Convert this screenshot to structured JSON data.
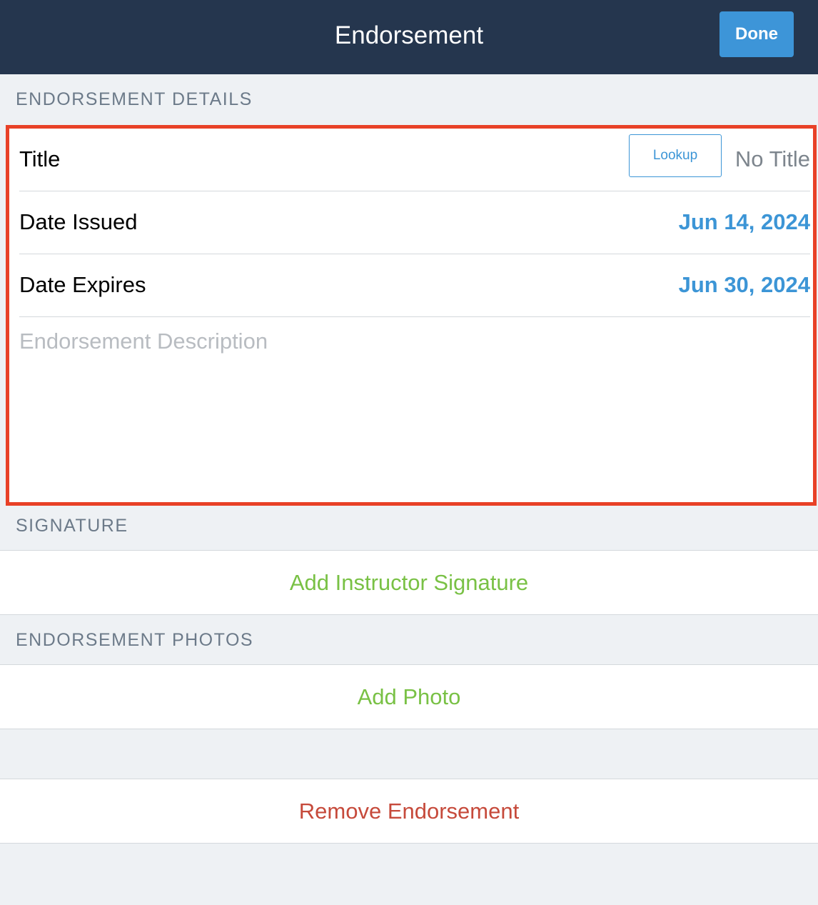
{
  "navbar": {
    "title": "Endorsement",
    "done_label": "Done"
  },
  "sections": {
    "details_header": "ENDORSEMENT DETAILS",
    "signature_header": "SIGNATURE",
    "photos_header": "ENDORSEMENT PHOTOS"
  },
  "details": {
    "title_label": "Title",
    "lookup_label": "Lookup",
    "title_value": "No Title",
    "date_issued_label": "Date Issued",
    "date_issued_value": "Jun 14, 2024",
    "date_expires_label": "Date Expires",
    "date_expires_value": "Jun 30, 2024",
    "description_placeholder": "Endorsement Description"
  },
  "actions": {
    "add_signature": "Add Instructor Signature",
    "add_photo": "Add Photo",
    "remove": "Remove Endorsement"
  },
  "colors": {
    "navbar": "#25364e",
    "accent_blue": "#3c95d6",
    "highlight_border": "#e84127",
    "add_green": "#79c145",
    "remove_red": "#c64a3b"
  }
}
